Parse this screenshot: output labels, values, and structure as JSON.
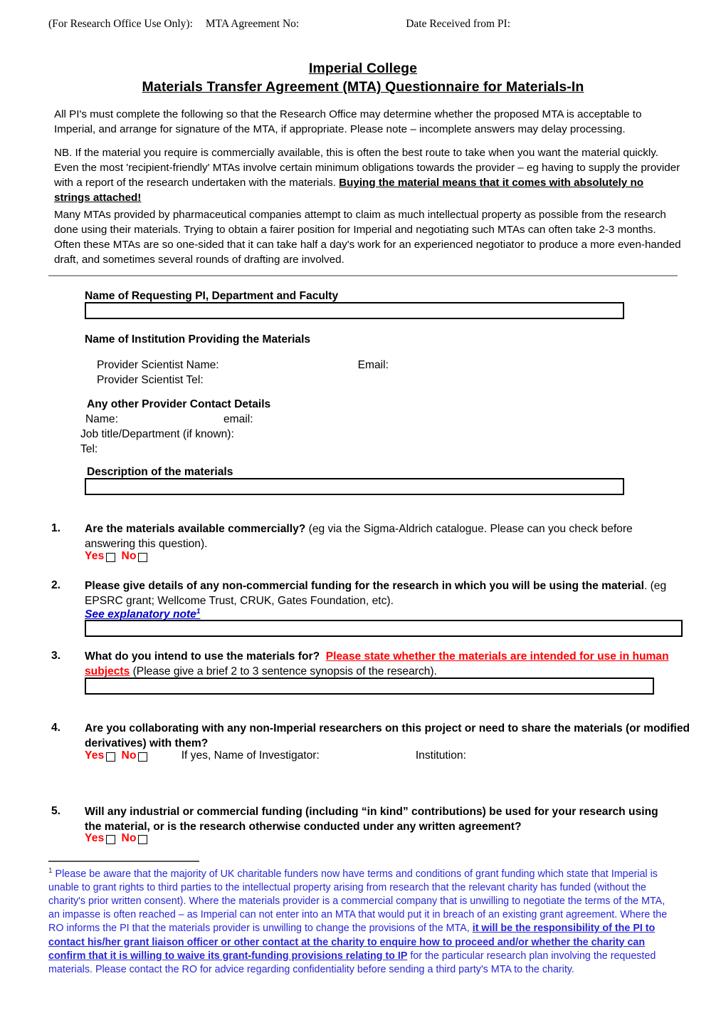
{
  "office_header": {
    "label": "(For Research Office Use Only):",
    "agreement_no": "MTA Agreement No:",
    "date_received": "Date Received from PI:"
  },
  "title": {
    "line1": "Imperial College",
    "line2": "Materials Transfer Agreement (MTA) Questionnaire for Materials-In"
  },
  "intro": {
    "para1": "All PI's must complete the following so that the Research Office may determine whether the proposed MTA is acceptable to Imperial, and arrange for signature of the MTA, if appropriate.  Please note – incomplete answers may delay processing.",
    "para2_lead": "NB. If the material you require is commercially available, this is often the best route to take when you want the material quickly.  Even the most 'recipient-friendly' MTAs involve certain minimum obligations towards the provider – eg having to supply the provider with a report of the research undertaken with the materials.  ",
    "para2_emphasis": "Buying the material means that it comes with absolutely no strings attached!",
    "para3": "Many MTAs provided by pharmaceutical companies attempt to claim as much intellectual property as possible from the research done using their materials.   Trying to obtain a fairer position for Imperial and negotiating such MTAs can often take 2-3 months.   Often these MTAs are so one-sided that it can take half a day's work for an experienced negotiator to produce a more even-handed draft, and sometimes several rounds of drafting are involved."
  },
  "fields": {
    "pi_name_heading": "Name of Requesting PI, Department and Faculty",
    "pi_name_value": "",
    "institution_heading": "Name of Institution Providing the Materials",
    "provider_scientist_name_label": "Provider Scientist Name:",
    "provider_scientist_email_label": "Email:",
    "provider_scientist_tel_label": "Provider Scientist Tel:",
    "other_contact_heading": "Any other Provider Contact Details",
    "other_name_label": "Name:",
    "other_email_label": "email:",
    "other_jobtitle_label": "Job title/Department (if known):",
    "other_tel_label": "Tel:",
    "description_heading": "Description of the materials",
    "description_value": ""
  },
  "questions": [
    {
      "number": "1.",
      "strong": "Are the materials available commercially?",
      "normal": "  (eg via the Sigma-Aldrich catalogue.  Please can you check before answering this question).",
      "yes_label": "Yes",
      "no_label": "No"
    },
    {
      "number": "2.",
      "strong": "Please give details of any non-commercial funding for the research in which you will be using the material",
      "normal": ".  (eg EPSRC grant; Wellcome Trust, CRUK, Gates Foundation, etc).",
      "link_label": "See explanatory note",
      "link_sup": "1",
      "answer_value": ""
    },
    {
      "number": "3.",
      "strong": "What do you intend to use the materials for?",
      "red": "Please state whether the materials are intended for use in human subjects",
      "normal": " (Please give a brief 2 to 3 sentence synopsis of the research).",
      "answer_value": ""
    },
    {
      "number": "4.",
      "strong": "Are you collaborating with any non-Imperial researchers on this project or need to share the materials (or modified derivatives) with them?",
      "yes_label": "Yes",
      "no_label": "No",
      "investigator_label": "If yes, Name of Investigator:",
      "institution_label": "Institution:"
    },
    {
      "number": "5.",
      "strong": "Will any industrial or commercial funding (including “in kind” contributions) be used for your research using the material, or is the research otherwise conducted under any written agreement?",
      "yes_label": "Yes",
      "no_label": "No"
    }
  ],
  "footnote": {
    "marker": "1",
    "part1": " Please be aware that the majority of UK charitable funders now have terms and conditions of grant funding which state that Imperial is unable to grant rights to third parties to the intellectual property arising from research that the relevant charity has funded (without the charity's prior written consent).    Where the materials provider is a commercial company that is unwilling to negotiate the terms of the MTA, an impasse is often reached – as Imperial can not enter into an MTA that would put it in breach of an existing grant agreement.   Where the RO informs the PI that the materials provider is unwilling to change the provisions of the MTA, ",
    "emphasis": "it will be the responsibility of the PI to contact his/her grant liaison officer or other contact at the charity to enquire how to proceed and/or whether the charity can confirm that it is willing to waive its grant-funding provisions relating to IP",
    "part2": " for the particular research plan involving the requested materials.    Please contact the RO for advice regarding confidentiality before sending a third party's MTA to the charity."
  },
  "colors": {
    "red": "#ff0000",
    "blue_link": "#0000cc",
    "footnote_blue": "#2727d8",
    "divider_gray": "#9a9a9a"
  }
}
